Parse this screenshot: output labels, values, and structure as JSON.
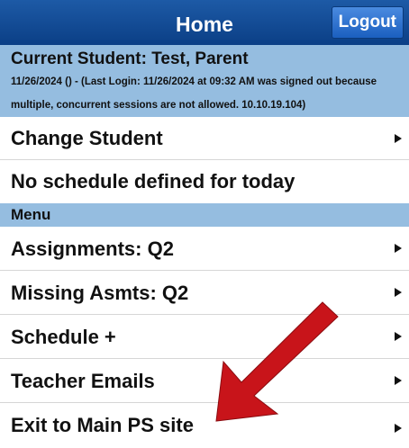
{
  "header": {
    "title": "Home",
    "logout_label": "Logout"
  },
  "student": {
    "current": "Current Student: Test, Parent",
    "info": "11/26/2024 () - (Last Login: 11/26/2024 at 09:32 AM was signed out because multiple, concurrent sessions are not allowed. 10.10.19.104)"
  },
  "rows": {
    "change_student": "Change Student",
    "no_schedule": "No schedule defined for today"
  },
  "menu": {
    "header": "Menu",
    "items": [
      {
        "label": "Assignments: Q2"
      },
      {
        "label": "Missing Asmts: Q2"
      },
      {
        "label": "Schedule +"
      },
      {
        "label": "Teacher Emails"
      },
      {
        "label": "Exit to Main PS site"
      }
    ]
  },
  "colors": {
    "header_blue": "#0b3f86",
    "section_blue": "#95bde0",
    "annotation_red": "#c8141a"
  },
  "icons": {
    "row_arrow": "chevron-right-icon",
    "annotation": "red-arrow-icon"
  }
}
